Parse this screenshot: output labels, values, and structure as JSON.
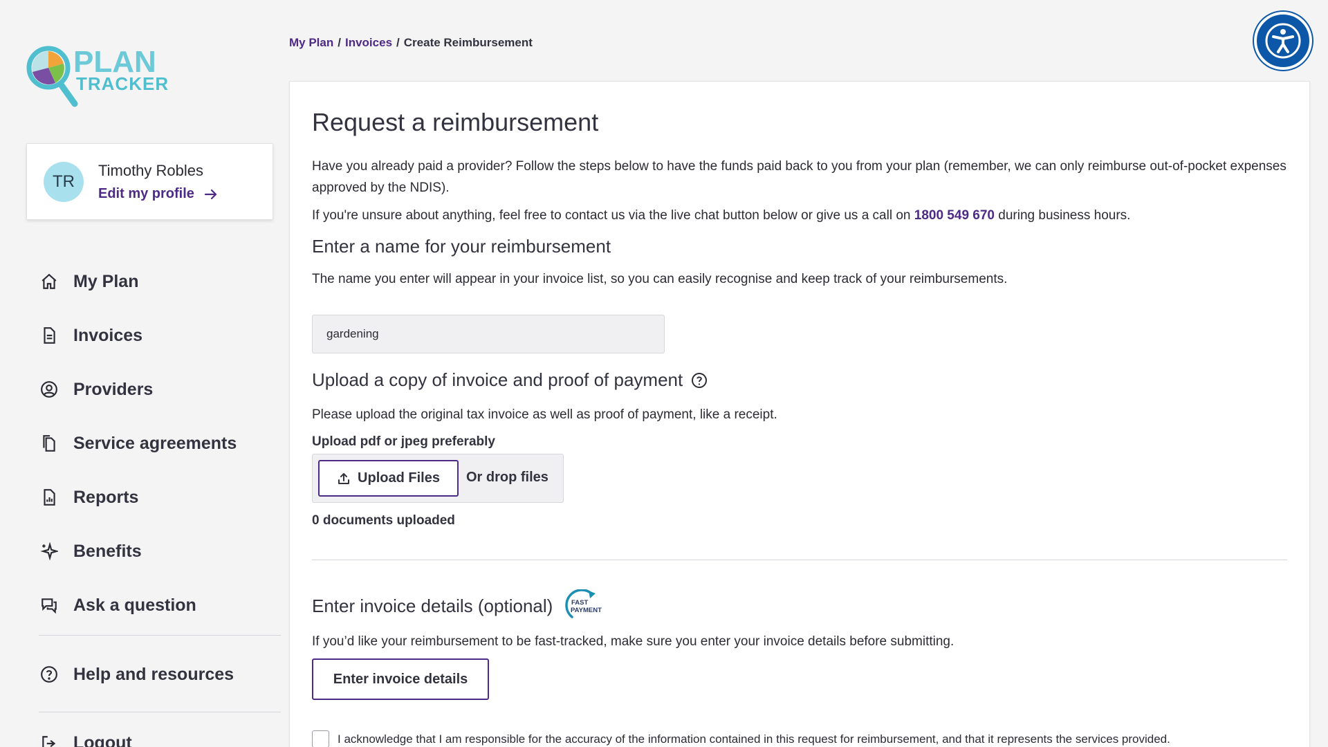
{
  "brand": {
    "line1": "PLAN",
    "line2": "TRACKER"
  },
  "profile": {
    "initials": "TR",
    "name": "Timothy Robles",
    "edit_label": "Edit my profile"
  },
  "nav": {
    "items": [
      {
        "label": "My Plan",
        "icon": "home-icon"
      },
      {
        "label": "Invoices",
        "icon": "document-icon"
      },
      {
        "label": "Providers",
        "icon": "user-circle-icon"
      },
      {
        "label": "Service agreements",
        "icon": "documents-icon"
      },
      {
        "label": "Reports",
        "icon": "report-icon"
      },
      {
        "label": "Benefits",
        "icon": "sparkle-icon"
      },
      {
        "label": "Ask a question",
        "icon": "chat-icon"
      }
    ],
    "help_label": "Help and resources",
    "partial_label": "Logout"
  },
  "breadcrumb": {
    "first": "My Plan",
    "second": "Invoices",
    "current": "Create Reimbursement",
    "sep": "/"
  },
  "main": {
    "title": "Request a reimbursement",
    "intro_1": "Have you already paid a provider? Follow the steps below to have the funds paid back to you from your plan (remember, we can only reimburse out-of-pocket expenses approved by the NDIS).",
    "intro_2_before": "If you're unsure about anything, feel free to contact us via the live chat button below or give us a call on ",
    "intro_2_phone": "1800 549 670",
    "intro_2_after": " during business hours.",
    "name_heading": "Enter a name for your reimbursement",
    "name_desc": "The name you enter will appear in your invoice list, so you can easily recognise and keep track of your reimbursements.",
    "name_value": "gardening",
    "upload_heading": "Upload a copy of invoice and proof of payment",
    "upload_desc": "Please upload the original tax invoice as well as proof of payment, like a receipt.",
    "upload_hint": "Upload pdf or jpeg preferably",
    "upload_button": "Upload Files",
    "drop_text": "Or drop files",
    "docs_count": "0 documents uploaded",
    "details_heading": "Enter invoice details (optional)",
    "badge_line1": "FAST",
    "badge_line2": "PAYMENT",
    "details_desc": "If you’d like your reimbursement to be fast-tracked, make sure you enter your invoice details before submitting.",
    "details_button": "Enter invoice details",
    "ack_text": "I acknowledge that I am responsible for the accuracy of the information contained in this request for reimbursement, and that it represents the services provided."
  },
  "colors": {
    "accent": "#4d2a86",
    "accessibility": "#0c57a8",
    "logo_teal": "#4fbfcf"
  }
}
